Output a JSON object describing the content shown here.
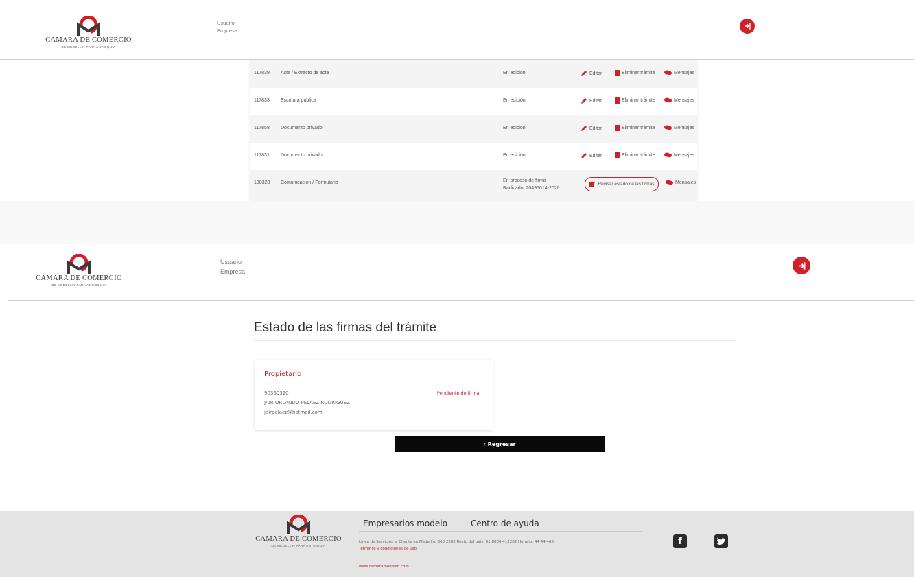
{
  "colors": {
    "accent": "#d0202a",
    "footer_bg": "#e4e4e4",
    "button_bg": "#0a0a0a"
  },
  "header": {
    "logo_name": "CAMARA DE COMERCIO",
    "logo_sub": "DE MEDELLIN PARA ANTIOQUIA",
    "user_label": "Usuario",
    "company_label": "Empresa",
    "logout_icon": "sign-out-icon"
  },
  "list": {
    "rows": [
      {
        "id": "117839",
        "type": "Acta / Extracto de acta",
        "state": "En edición",
        "edit": "Editar",
        "delete": "Eliminar trámite",
        "messages": "Mensajes"
      },
      {
        "id": "117833",
        "type": "Escritura pública",
        "state": "En edición",
        "edit": "Editar",
        "delete": "Eliminar trámite",
        "messages": "Mensajes"
      },
      {
        "id": "117858",
        "type": "Documento privado",
        "state": "En edición",
        "edit": "Editar",
        "delete": "Eliminar trámite",
        "messages": "Mensajes"
      },
      {
        "id": "117831",
        "type": "Documento privado",
        "state": "En edición",
        "edit": "Editar",
        "delete": "Eliminar trámite",
        "messages": "Mensajes"
      }
    ],
    "last_row": {
      "id": "130328",
      "type": "Comunicación / Formulario",
      "state_line1": "En proceso de firma",
      "state_line2": "Radicado: 20495014-2020",
      "review": "Revisar estado de las firmas",
      "messages": "Mensajes"
    }
  },
  "detail": {
    "title": "Estado de las firmas del trámite",
    "card": {
      "role": "Propietario",
      "id_number": "90360320",
      "name": "JAIR ORLANDO PELAEZ RODRIGUEZ",
      "email": "jairpelaez@hotmail.com",
      "status": "Pendiente de firma"
    },
    "back_button": "‹ Regresar"
  },
  "footer": {
    "link1": "Empresarios modelo",
    "link2": "Centro de ayuda",
    "contact": "Línea de Servicios al Cliente en Medellín: 360 2282 Resto del país: 01 8000 412282 Horario: 44 44 468",
    "legal": "Términos y condiciones de uso",
    "url": "www.camaramedellin.com",
    "facebook": "f",
    "twitter": "t"
  }
}
